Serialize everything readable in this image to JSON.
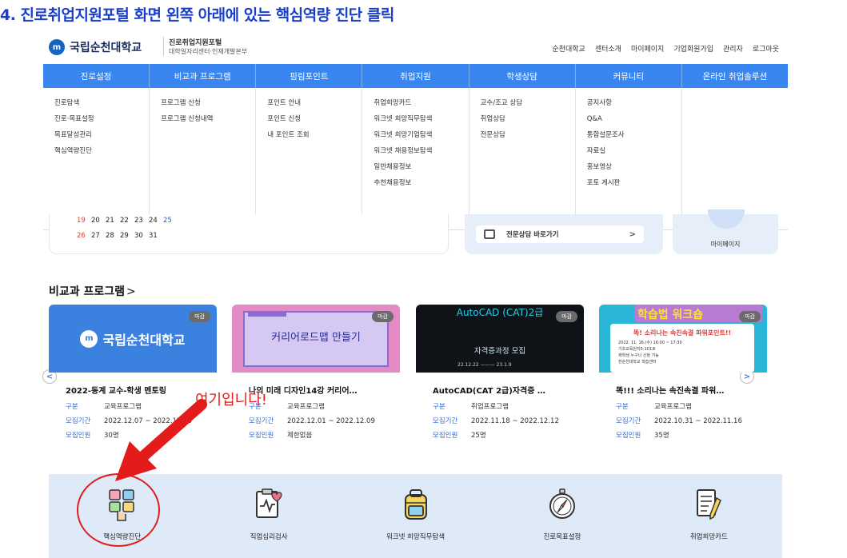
{
  "instruction": "4. 진로취업지원포털 화면 왼쪽 아래에 있는 핵심역량 진단 클릭",
  "header": {
    "logo_mark": "m",
    "university": "국립순천대학교",
    "portal_title": "진로취업지원포털",
    "portal_sub": "대학일자리센터·인재개발본부",
    "links": [
      "순천대학교",
      "센터소개",
      "마이페이지",
      "기업회원가입",
      "관리자",
      "로그아웃"
    ]
  },
  "nav": [
    "진로설정",
    "비교과 프로그램",
    "핑림포인트",
    "취업지원",
    "학생상담",
    "커뮤니티",
    "온라인 취업솔루션"
  ],
  "dropdown": [
    [
      "진로탐색",
      "진로·목표설정",
      "목표달성관리",
      "핵심역량진단"
    ],
    [
      "프로그램 신청",
      "프로그램 신청내역"
    ],
    [
      "포인트 안내",
      "포인트 신청",
      "내 포인트 조회"
    ],
    [
      "취업희망카드",
      "워크넷 희망직무탐색",
      "워크넷 희망기업탐색",
      "워크넷 채용정보탐색",
      "일반채용정보",
      "추천채용정보"
    ],
    [
      "교수/조교 상담",
      "취업상담",
      "전문상담"
    ],
    [
      "공지사항",
      "Q&A",
      "통합설문조사",
      "자료실",
      "홍보영상",
      "포토 게시판"
    ],
    []
  ],
  "calendar": {
    "rows": [
      [
        "19",
        "20",
        "21",
        "22",
        "23",
        "24",
        "25"
      ],
      [
        "26",
        "27",
        "28",
        "29",
        "30",
        "31"
      ]
    ]
  },
  "counsel_button": "전문상담 바로가기",
  "counsel_arrow": ">",
  "mypage": "마이페이지",
  "section": {
    "title": "비교과 프로그램",
    "caret": ">",
    "prev": "<",
    "next": ">"
  },
  "cards": [
    {
      "badge": "마감",
      "thumb_text": "국립순천대학교",
      "title": "2022-동계 교수-학생 멘토링",
      "rows": [
        {
          "k": "구분",
          "v": "교육프로그램"
        },
        {
          "k": "모집기간",
          "v": "2022.12.07 ~ 2022.12.13"
        },
        {
          "k": "모집인원",
          "v": "30명"
        }
      ]
    },
    {
      "badge": "마감",
      "thumb_text": "커리어로드맵 만들기",
      "title": "나의 미래 디자인14강 커리어…",
      "rows": [
        {
          "k": "구분",
          "v": "교육프로그램"
        },
        {
          "k": "모집기간",
          "v": "2022.12.01 ~ 2022.12.09"
        },
        {
          "k": "모집인원",
          "v": "제한없음"
        }
      ]
    },
    {
      "badge": "마감",
      "thumb_text": "AutoCAD (CAT)2급",
      "thumb_sub": "자격증과정 모집",
      "thumb_date": "22.12.22 ——— 23.1.9",
      "title": "AutoCAD(CAT 2급)자격증 …",
      "rows": [
        {
          "k": "구분",
          "v": "취업프로그램"
        },
        {
          "k": "모집기간",
          "v": "2022.11.18 ~ 2022.12.12"
        },
        {
          "k": "모집인원",
          "v": "25명"
        }
      ]
    },
    {
      "badge": "마감",
      "thumb_text": "학습법 워크숍",
      "thumb_sub": "똑! 소리나는 속진속결 파워포인트!!",
      "thumb_lines": [
        "2022. 11. 16.(수) 16:00 ~ 17:30",
        "기초교육원지5-101호",
        "재학생 누구나 신청 가능",
        "한순천대학교 학습센터"
      ],
      "title": "똑!!! 소리나는 속진속결 파워…",
      "rows": [
        {
          "k": "구분",
          "v": "교육프로그램"
        },
        {
          "k": "모집기간",
          "v": "2022.10.31 ~ 2022.11.16"
        },
        {
          "k": "모집인원",
          "v": "35명"
        }
      ]
    }
  ],
  "annotation": "여기입니다!",
  "quick_links": [
    "핵심역량진단",
    "직업심리검사",
    "워크넷 희망직무탐색",
    "진로목표설정",
    "취업희망카드"
  ],
  "colors": {
    "instruction": "#1a3ec9",
    "nav": "#3a86f0",
    "annotation": "#e31b1b",
    "quickbar": "#dfeaf8"
  }
}
